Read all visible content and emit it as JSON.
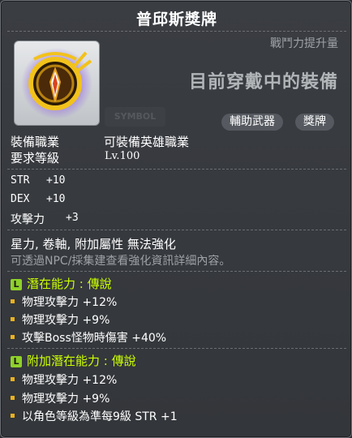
{
  "item": {
    "name": "普邱斯獎牌",
    "power_label": "戰鬥力提升量",
    "equipped_label": "目前穿戴中的裝備",
    "symbol_ghost": "SYMBOL",
    "tags": [
      "輔助武器",
      "獎牌"
    ],
    "job_label": "裝備職業",
    "job_value": "可裝備英雄職業",
    "level_label": "要求等級",
    "level_value": "Lv.100"
  },
  "stats": [
    {
      "name": "STR",
      "value": "+10"
    },
    {
      "name": "DEX",
      "value": "+10"
    },
    {
      "name": "攻擊力",
      "value": "+3"
    }
  ],
  "notes": {
    "cannot_enhance": "星力, 卷軸, 附加屬性 無法強化",
    "hint": "可透過NPC/採集建查看強化資訊詳細內容。"
  },
  "potential": {
    "badge": "L",
    "header": "潛在能力 : 傳說",
    "lines": [
      "物理攻擊力 +12%",
      "物理攻擊力 +9%",
      "攻擊Boss怪物時傷害 +40%"
    ]
  },
  "bonus_potential": {
    "badge": "L",
    "header": "附加潛在能力 : 傳說",
    "lines": [
      "物理攻擊力 +12%",
      "物理攻擊力 +9%",
      "以角色等級為準每9級 STR +1"
    ]
  },
  "colors": {
    "legendary": "#ccff00",
    "bullet": "#e9b21e",
    "badge": "#8fd12a",
    "hint": "#9ea2a6"
  },
  "icons": {
    "item_icon": "gold-medal-icon",
    "badge_icon": "legendary-rank-badge",
    "bullet_icon": "yellow-square-bullet"
  }
}
